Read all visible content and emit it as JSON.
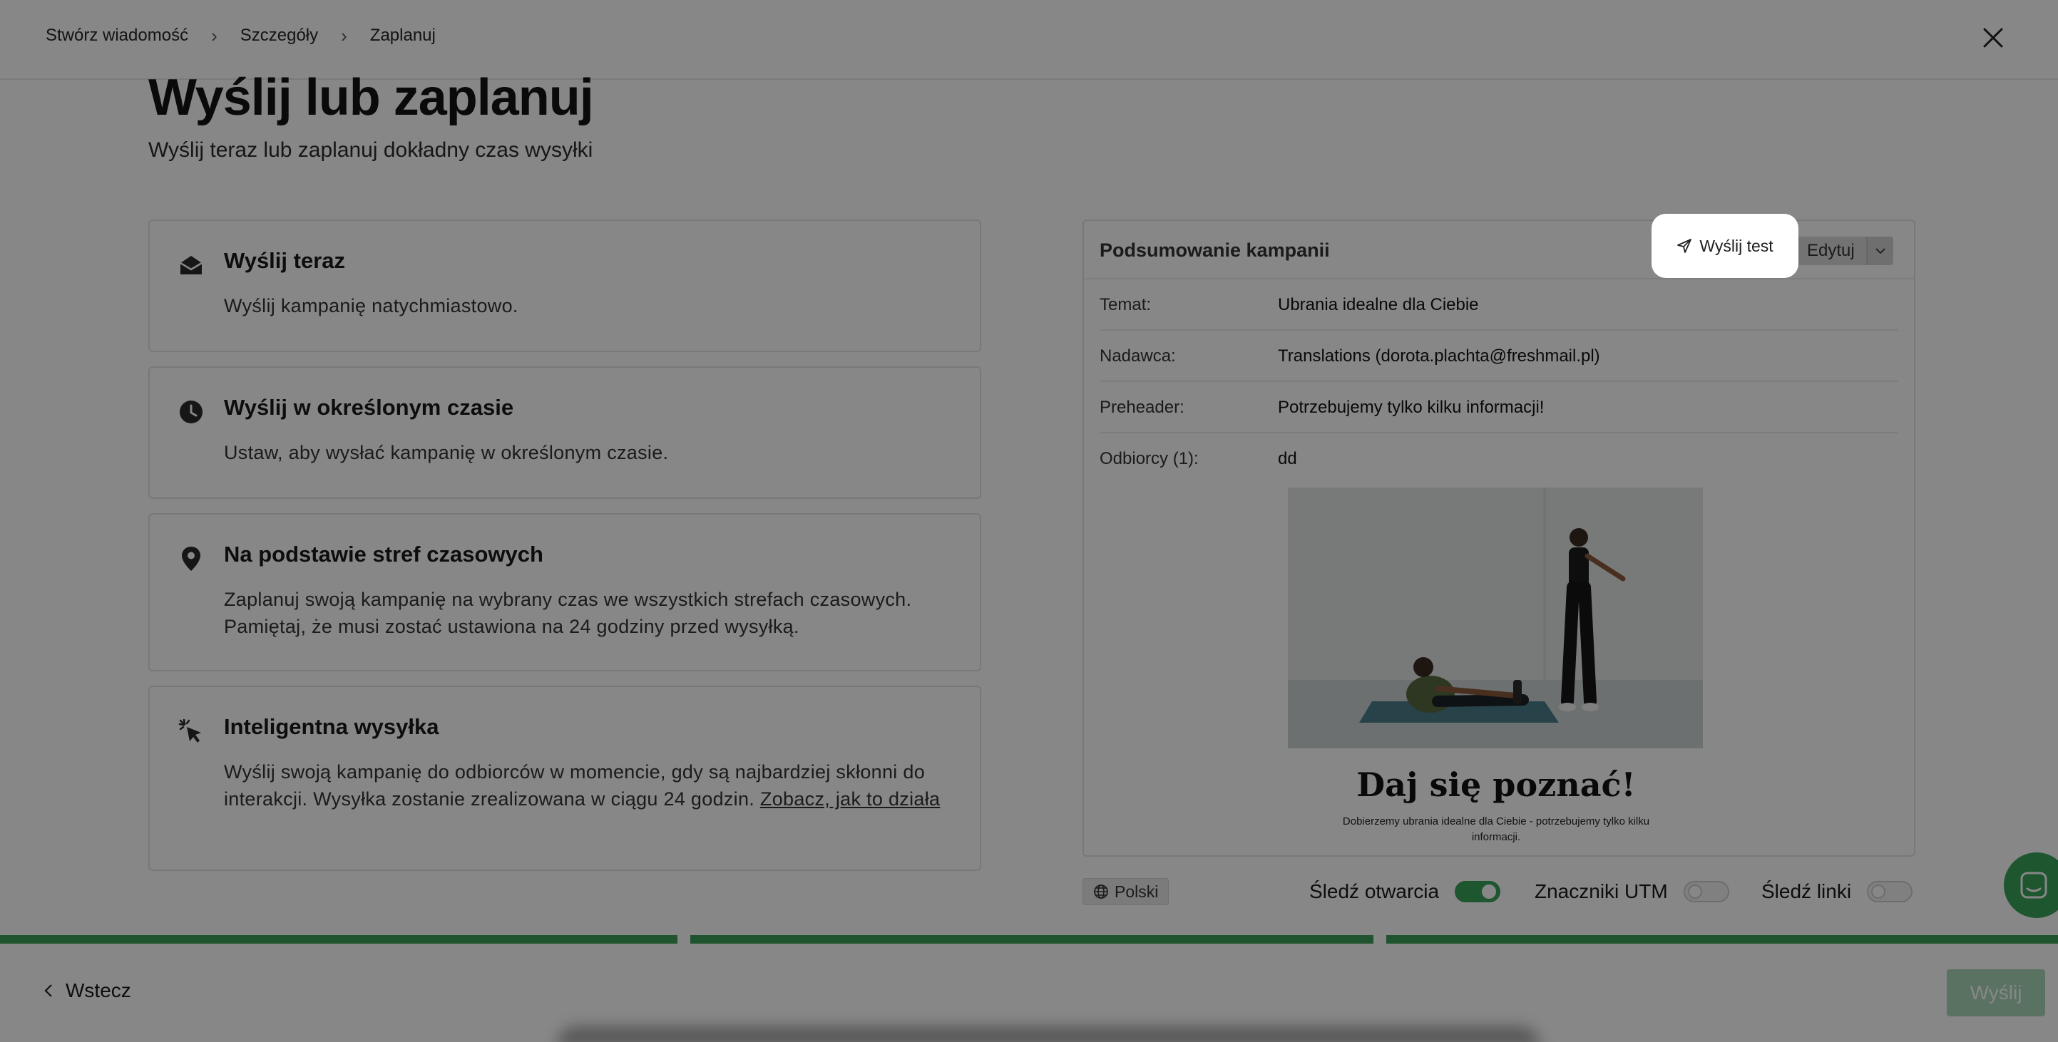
{
  "breadcrumb": {
    "items": [
      "Stwórz wiadomość",
      "Szczegóły",
      "Zaplanuj"
    ],
    "separator": "›"
  },
  "page": {
    "title": "Wyślij lub zaplanuj",
    "subtitle": "Wyślij teraz lub zaplanuj dokładny czas wysyłki"
  },
  "options": [
    {
      "icon": "envelope-open-icon",
      "title": "Wyślij teraz",
      "description": "Wyślij kampanię natychmiastowo."
    },
    {
      "icon": "clock-icon",
      "title": "Wyślij w określonym czasie",
      "description": "Ustaw, aby wysłać kampanię w określonym czasie."
    },
    {
      "icon": "map-pin-icon",
      "title": "Na podstawie stref czasowych",
      "description_line1": "Zaplanuj swoją kampanię na wybrany czas we wszystkich strefach czasowych.",
      "description_line2": "Pamiętaj, że musi zostać ustawiona na 24 godziny przed wysyłką."
    },
    {
      "icon": "cursor-click-icon",
      "title": "Inteligentna wysyłka",
      "description": "Wyślij swoją kampanię do odbiorców w momencie, gdy są najbardziej skłonni do interakcji. Wysyłka zostanie zrealizowana w ciągu 24 godzin.",
      "link": "Zobacz, jak to działa"
    }
  ],
  "summary": {
    "title": "Podsumowanie kampanii",
    "send_test_label": "Wyślij test",
    "edit_label": "Edytuj",
    "rows": [
      {
        "label": "Temat:",
        "value": "Ubrania idealne dla Ciebie"
      },
      {
        "label": "Nadawca:",
        "value": "Translations (dorota.plachta@freshmail.pl)"
      },
      {
        "label": "Preheader:",
        "value": "Potrzebujemy tylko kilku informacji!"
      },
      {
        "label": "Odbiorcy (1):",
        "value": "dd"
      }
    ],
    "preview": {
      "headline": "Daj się poznać!",
      "text": "Dobierzemy ubrania idealne dla Ciebie - potrzebujemy tylko kilku informacji."
    }
  },
  "settings": {
    "language": "Polski",
    "toggles": [
      {
        "label": "Śledź otwarcia",
        "on": true
      },
      {
        "label": "Znaczniki UTM",
        "on": false
      },
      {
        "label": "Śledź linki",
        "on": false
      }
    ]
  },
  "progress": {
    "steps_total": 3,
    "steps_complete": 3
  },
  "footer": {
    "back_label": "Wstecz",
    "send_label": "Wyślij"
  },
  "colors": {
    "accent": "#3c9f58",
    "send_disabled": "#a9d8b7",
    "overlay": "rgba(0,0,0,0.47)"
  }
}
